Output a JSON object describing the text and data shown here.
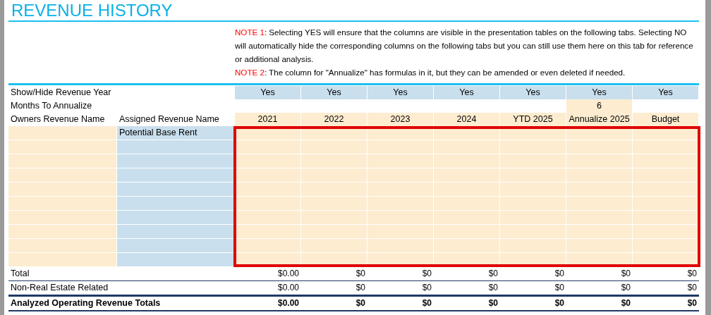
{
  "title": "REVENUE HISTORY",
  "notes": [
    {
      "label": "NOTE 1",
      "text": ": Selecting YES will ensure that the columns are visible in the presentation tables on the following tabs. Selecting NO will automatically hide the corresponding columns on the following tabs but you can still use them here on this tab for reference or additional analysis."
    },
    {
      "label": "NOTE 2",
      "text": ": The column for \"Annualize\" has formulas in it, but they can be amended or even deleted if needed."
    }
  ],
  "show_hide": {
    "label": "Show/Hide Revenue Year",
    "values": [
      "Yes",
      "Yes",
      "Yes",
      "Yes",
      "Yes",
      "Yes",
      "Yes"
    ]
  },
  "months": {
    "label": "Months To Annualize",
    "annualize_value": "6"
  },
  "header": {
    "column_1": "Owners Revenue Name",
    "column_2": "Assigned Revenue Name",
    "years": [
      "2021",
      "2022",
      "2023",
      "2024",
      "YTD 2025",
      "Annualize 2025",
      "Budget"
    ]
  },
  "input_area": {
    "highlighted": true,
    "rows": [
      {
        "assigned_name": "Potential Base Rent"
      },
      {},
      {},
      {},
      {},
      {},
      {},
      {},
      {},
      {}
    ]
  },
  "summary": [
    {
      "kind": "normal",
      "label": "Total",
      "values": [
        "$0.00",
        "$0",
        "$0",
        "$0",
        "$0",
        "$0",
        "$0"
      ]
    },
    {
      "kind": "normal",
      "label": "Non-Real Estate Related",
      "values": [
        "$0.00",
        "$0",
        "$0",
        "$0",
        "$0",
        "$0",
        "$0"
      ]
    },
    {
      "kind": "grand",
      "label": "Analyzed Operating Revenue Totals",
      "values": [
        "$0.00",
        "$0",
        "$0",
        "$0",
        "$0",
        "$0",
        "$0"
      ]
    }
  ]
}
